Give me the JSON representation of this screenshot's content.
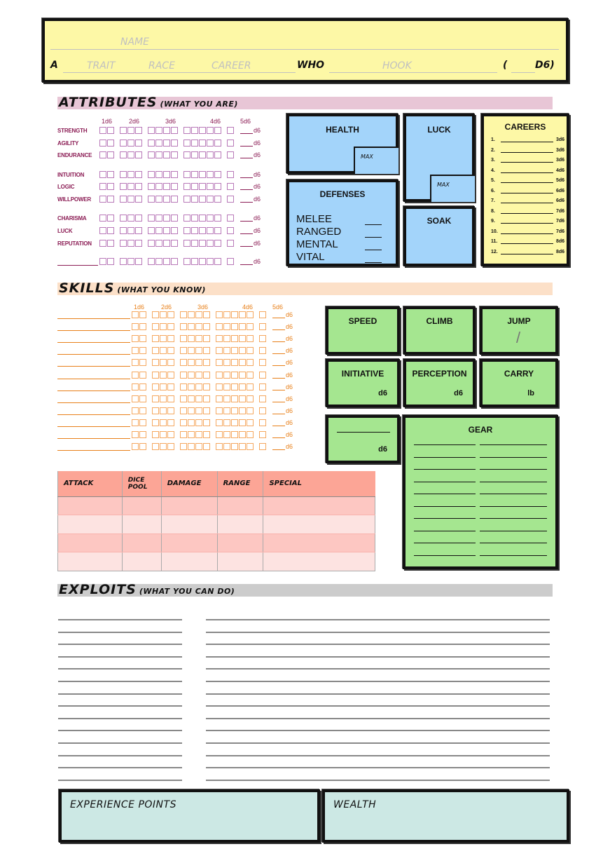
{
  "header": {
    "name_placeholder": "NAME",
    "prefix": "A",
    "trait_placeholder": "TRAIT",
    "race_placeholder": "RACE",
    "career_placeholder": "CAREER",
    "who": "WHO",
    "hook_placeholder": "HOOK",
    "open_paren": "(",
    "dice_suffix": "D6)"
  },
  "attributes": {
    "title": "ATTRIBUTES",
    "subtitle": "(WHAT YOU ARE)",
    "dice_headers": [
      "1d6",
      "2d6",
      "3d6",
      "4d6",
      "5d6"
    ],
    "suffix": "d6",
    "groups": [
      [
        "STRENGTH",
        "AGILITY",
        "ENDURANCE"
      ],
      [
        "INTUITION",
        "LOGIC",
        "WILLPOWER"
      ],
      [
        "CHARISMA",
        "LUCK",
        "REPUTATION"
      ]
    ],
    "custom_row": ""
  },
  "health": {
    "title": "HEALTH",
    "max_label": "MAX"
  },
  "luck": {
    "title": "LUCK",
    "max_label": "MAX"
  },
  "defenses": {
    "title": "DEFENSES",
    "items": [
      "MELEE",
      "RANGED",
      "MENTAL",
      "VITAL"
    ]
  },
  "soak": {
    "title": "SOAK"
  },
  "careers": {
    "title": "CAREERS",
    "rows": [
      {
        "num": "1.",
        "dice": "3d6"
      },
      {
        "num": "2.",
        "dice": "3d6"
      },
      {
        "num": "3.",
        "dice": "3d6"
      },
      {
        "num": "4.",
        "dice": "4d6"
      },
      {
        "num": "5.",
        "dice": "5d6"
      },
      {
        "num": "6.",
        "dice": "6d6"
      },
      {
        "num": "7.",
        "dice": "6d6"
      },
      {
        "num": "8.",
        "dice": "7d6"
      },
      {
        "num": "9.",
        "dice": "7d6"
      },
      {
        "num": "10.",
        "dice": "7d6"
      },
      {
        "num": "11.",
        "dice": "8d6"
      },
      {
        "num": "12.",
        "dice": "8d6"
      }
    ]
  },
  "skills": {
    "title": "SKILLS",
    "subtitle": "(WHAT YOU KNOW)",
    "dice_headers": [
      "1d6",
      "2d6",
      "3d6",
      "4d6",
      "5d6"
    ],
    "suffix": "d6",
    "row_count": 12
  },
  "stats": {
    "speed": "SPEED",
    "climb": "CLIMB",
    "jump": "JUMP",
    "jump_sep": "/",
    "initiative": "INITIATIVE",
    "initiative_unit": "d6",
    "perception": "PERCEPTION",
    "perception_unit": "d6",
    "carry": "CARRY",
    "carry_unit": "lb",
    "custom_unit": "d6"
  },
  "gear": {
    "title": "GEAR",
    "row_count": 10
  },
  "attacks": {
    "columns": [
      "ATTACK",
      "DICE POOL",
      "DAMAGE",
      "RANGE",
      "SPECIAL"
    ],
    "row_count": 4
  },
  "exploits": {
    "title": "EXPLOITS",
    "subtitle": "(WHAT YOU CAN DO)",
    "line_count": 14
  },
  "experience": {
    "title": "EXPERIENCE POINTS"
  },
  "wealth": {
    "title": "WEALTH"
  },
  "colors": {
    "header_yellow": "#fdf8a6",
    "attributes_bar": "#e8c6d6",
    "skills_bar": "#fce0c8",
    "exploits_bar": "#cccccc",
    "blue_box": "#a3d4fa",
    "green_box": "#a5e690",
    "teal_box": "#cce8e4",
    "attack_header": "#fca596",
    "attribute_text": "#8b1c54",
    "skill_text": "#e8801a"
  }
}
